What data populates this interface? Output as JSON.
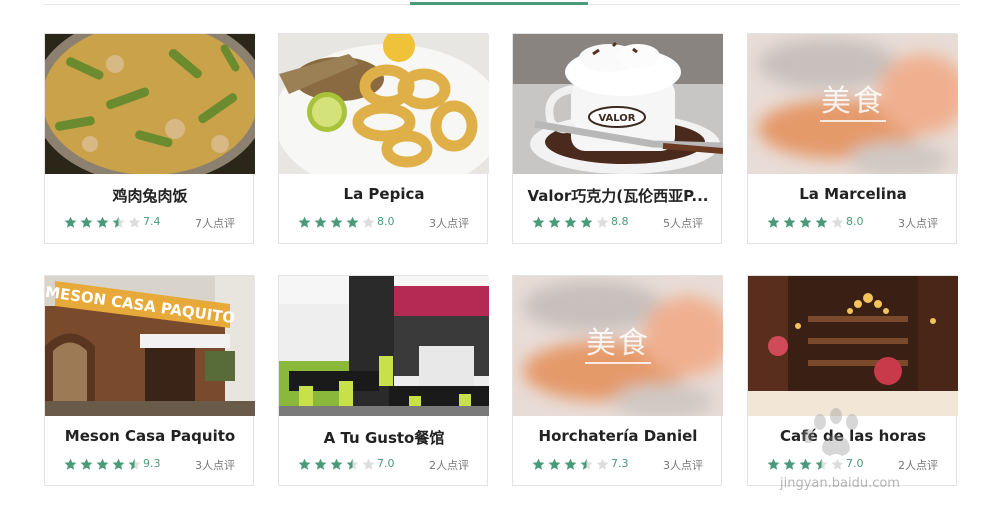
{
  "colors": {
    "accent": "#4a9b7a",
    "star_off": "#dddddd"
  },
  "placeholder_label": "美食",
  "cards": [
    {
      "name": "鸡肉兔肉饭",
      "rating": 3.5,
      "score": "7.4",
      "reviews": "7人点评",
      "image": "paella"
    },
    {
      "name": "La Pepica",
      "rating": 4,
      "score": "8.0",
      "reviews": "3人点评",
      "image": "calamari"
    },
    {
      "name": "Valor巧克力(瓦伦西亚P...",
      "rating": 4,
      "score": "8.8",
      "reviews": "5人点评",
      "image": "chocolate-cup"
    },
    {
      "name": "La Marcelina",
      "rating": 4,
      "score": "8.0",
      "reviews": "3人点评",
      "image": "placeholder"
    },
    {
      "name": "Meson Casa Paquito",
      "rating": 4.5,
      "score": "9.3",
      "reviews": "3人点评",
      "image": "restaurant-facade"
    },
    {
      "name": "A Tu Gusto餐馆",
      "rating": 3.5,
      "score": "7.0",
      "reviews": "2人点评",
      "image": "dining-room"
    },
    {
      "name": "Horchatería Daniel",
      "rating": 3.5,
      "score": "7.3",
      "reviews": "3人点评",
      "image": "placeholder"
    },
    {
      "name": "Café de las horas",
      "rating": 3.5,
      "score": "7.0",
      "reviews": "2人点评",
      "image": "cafe-interior"
    }
  ],
  "watermark": {
    "text": "jingyan.baidu.com"
  }
}
